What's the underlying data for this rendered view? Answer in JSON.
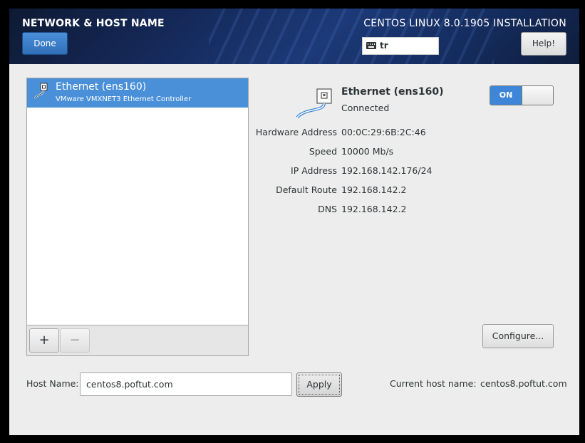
{
  "header": {
    "title": "NETWORK & HOST NAME",
    "done_label": "Done",
    "product": "CENTOS LINUX 8.0.1905 INSTALLATION",
    "keyboard_layout": "tr",
    "help_label": "Help!"
  },
  "connections": {
    "items": [
      {
        "name": "Ethernet (ens160)",
        "description": "VMware VMXNET3 Ethernet Controller",
        "icon": "ethernet-icon",
        "selected": true
      }
    ],
    "add_label": "+",
    "remove_label": "−"
  },
  "detail": {
    "name": "Ethernet (ens160)",
    "status": "Connected",
    "switch_label": "ON",
    "properties": [
      {
        "label": "Hardware Address",
        "value": "00:0C:29:6B:2C:46"
      },
      {
        "label": "Speed",
        "value": "10000 Mb/s"
      },
      {
        "label": "IP Address",
        "value": "192.168.142.176/24"
      },
      {
        "label": "Default Route",
        "value": "192.168.142.2"
      },
      {
        "label": "DNS",
        "value": "192.168.142.2"
      }
    ],
    "configure_label": "Configure..."
  },
  "hostname": {
    "label": "Host Name:",
    "value": "centos8.poftut.com",
    "apply_label": "Apply",
    "current_label": "Current host name:",
    "current_value": "centos8.poftut.com"
  },
  "colors": {
    "accent": "#4a90d9",
    "switch_on": "#3d86d8",
    "header_bg": "#15295a",
    "content_bg": "#ededed"
  }
}
